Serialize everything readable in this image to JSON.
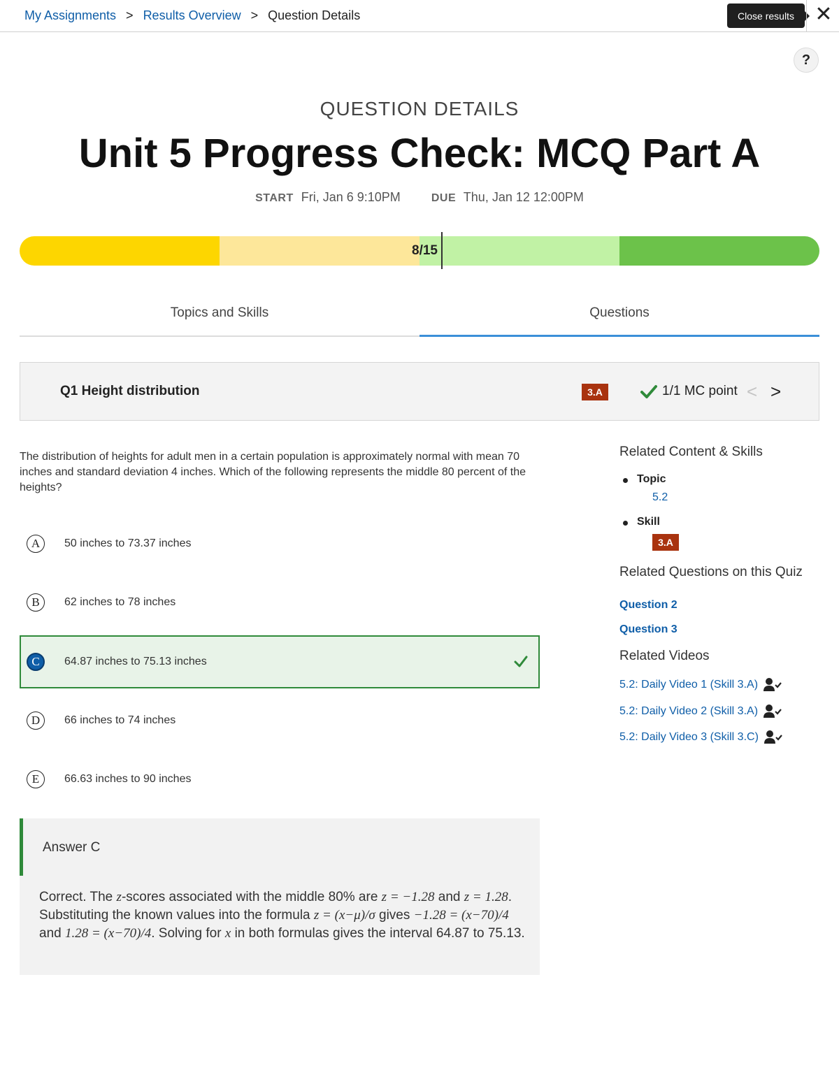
{
  "breadcrumb": {
    "items": [
      "My Assignments",
      "Results Overview"
    ],
    "current": "Question Details",
    "separator": ">"
  },
  "close": {
    "tooltip": "Close results",
    "icon": "close-icon"
  },
  "help": {
    "label": "?"
  },
  "header": {
    "kicker": "QUESTION DETAILS",
    "title": "Unit 5 Progress Check: MCQ Part A",
    "start_label": "START",
    "start_value": "Fri, Jan 6 9:10PM",
    "due_label": "DUE",
    "due_value": "Thu, Jan 12 12:00PM"
  },
  "progress": {
    "score": "8/15",
    "correct": 8,
    "total": 15,
    "band_colors": [
      "#fdd600",
      "#fde79a",
      "#c1f2a5",
      "#6cc24a"
    ]
  },
  "tabs": [
    {
      "label": "Topics and Skills",
      "active": false
    },
    {
      "label": "Questions",
      "active": true
    }
  ],
  "question": {
    "title": "Q1 Height distribution",
    "skill_badge": "3.A",
    "points": "1/1 MC point",
    "text": "The distribution of heights for adult men in a certain population is approximately normal with mean 70 inches and standard deviation 4 inches. Which of the following represents the middle 80 percent of the heights?",
    "choices": [
      {
        "letter": "A",
        "text": "50 inches to 73.37 inches",
        "correct": false
      },
      {
        "letter": "B",
        "text": "62 inches to 78 inches",
        "correct": false
      },
      {
        "letter": "C",
        "text": "64.87 inches to 75.13 inches",
        "correct": true
      },
      {
        "letter": "D",
        "text": "66 inches to 74 inches",
        "correct": false
      },
      {
        "letter": "E",
        "text": "66.63 inches to 90 inches",
        "correct": false
      }
    ]
  },
  "explanation": {
    "title": "Answer C",
    "p1": "Correct. The ",
    "p2": "-scores associated with the middle 80% are ",
    "p3": "z = −1.28",
    "p4": " and ",
    "p5": "z = 1.28",
    "p6": ". Substituting the known values into the formula ",
    "p7": "z = (x−μ)/σ",
    "p8": " gives ",
    "p9": "−1.28 = (x−70)/4",
    "p10": " and ",
    "p11": "1.28 = (x−70)/4",
    "p12": ". Solving for ",
    "p13": "x",
    "p14": " in both formulas gives the interval 64.87 to 75.13.",
    "zvar": "z"
  },
  "side": {
    "related_heading": "Related Content & Skills",
    "topic_label": "Topic",
    "topic_value": "5.2",
    "skill_label": "Skill",
    "skill_value": "3.A",
    "questions_heading": "Related Questions on this Quiz",
    "questions": [
      "Question 2",
      "Question 3"
    ],
    "videos_heading": "Related Videos",
    "videos": [
      "5.2: Daily Video 1 (Skill 3.A)",
      "5.2: Daily Video 2 (Skill 3.A)",
      "5.2: Daily Video 3 (Skill 3.C)"
    ]
  },
  "colors": {
    "link": "#0f5ea8",
    "badge": "#a9330f",
    "correct_green": "#2f8a3a",
    "tab_active": "#3b8fd8"
  }
}
